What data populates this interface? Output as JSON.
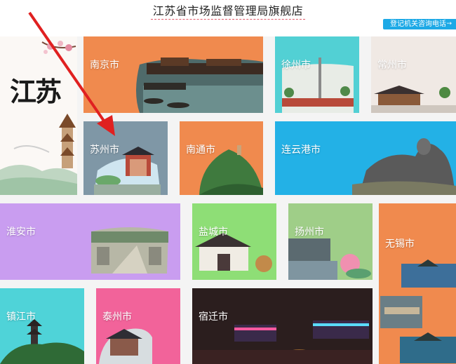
{
  "header": {
    "title": "江苏省市场监督管理局旗舰店",
    "phone_button": "登记机关咨询电话",
    "phone_arrow": "→"
  },
  "tiles": {
    "jiangsu": {
      "brand": "江苏"
    },
    "nanjing": {
      "label": "南京市",
      "color": "#f08a4e"
    },
    "xuzhou": {
      "label": "徐州市",
      "color": "#52d0d4"
    },
    "changzhou": {
      "label": "常州市",
      "color": "#f0e9e4"
    },
    "suzhou": {
      "label": "苏州市",
      "color": "#7f97a6"
    },
    "nantong": {
      "label": "南通市",
      "color": "#f08a4e"
    },
    "lianyungang": {
      "label": "连云港市",
      "color": "#23b1e6"
    },
    "huaian": {
      "label": "淮安市",
      "color": "#c99df0"
    },
    "yancheng": {
      "label": "盐城市",
      "color": "#8ede76"
    },
    "yangzhou": {
      "label": "扬州市",
      "color": "#9fce88"
    },
    "wuxi": {
      "label": "无锡市",
      "color": "#f08a4e"
    },
    "zhenjiang": {
      "label": "镇江市",
      "color": "#4fd3d8"
    },
    "taizhou": {
      "label": "泰州市",
      "color": "#f2639a"
    },
    "suqian": {
      "label": "宿迁市",
      "color": "#2b1e1e"
    }
  }
}
